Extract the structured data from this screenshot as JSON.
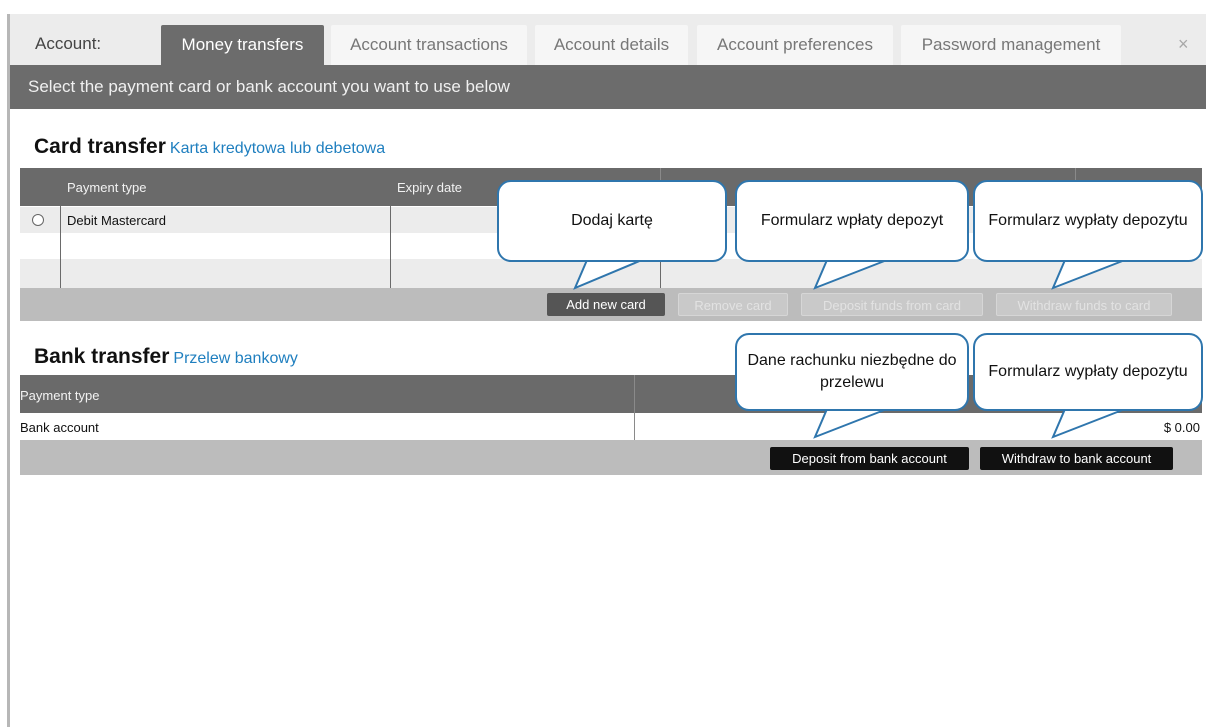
{
  "tabs": {
    "account_label": "Account:",
    "items": [
      {
        "label": "Money transfers",
        "active": true
      },
      {
        "label": "Account transactions",
        "active": false
      },
      {
        "label": "Account details",
        "active": false
      },
      {
        "label": "Account preferences",
        "active": false
      },
      {
        "label": "Password management",
        "active": false
      }
    ],
    "close": "×"
  },
  "subheader": "Select the payment card or bank account you want to use below",
  "card_transfer": {
    "title": "Card transfer",
    "subtitle": "Karta kredytowa lub debetowa",
    "columns": [
      "Payment type",
      "Expiry date"
    ],
    "rows": [
      {
        "payment_type": "Debit Mastercard",
        "expiry_date": ""
      }
    ],
    "buttons": {
      "add": "Add new card",
      "remove": "Remove card",
      "deposit": "Deposit funds from card",
      "withdraw": "Withdraw funds to card"
    }
  },
  "bank_transfer": {
    "title": "Bank transfer",
    "subtitle": "Przelew bankowy",
    "columns": [
      "Payment type"
    ],
    "rows": [
      {
        "payment_type": "Bank account",
        "balance": "$ 0.00"
      }
    ],
    "buttons": {
      "deposit": "Deposit from bank account",
      "withdraw": "Withdraw to bank account"
    }
  },
  "callouts": {
    "add_card": "Dodaj kartę",
    "deposit_card": "Formularz wpłaty depozyt",
    "withdraw_card": "Formularz wypłaty depozytu",
    "bank_details": "Dane rachunku niezbędne do przelewu",
    "bank_withdraw": "Formularz wypłaty depozytu"
  },
  "colors": {
    "header_gray": "#6c6c6c",
    "callout_border": "#2f76ad",
    "subtitle_blue": "#1f7fbf"
  }
}
